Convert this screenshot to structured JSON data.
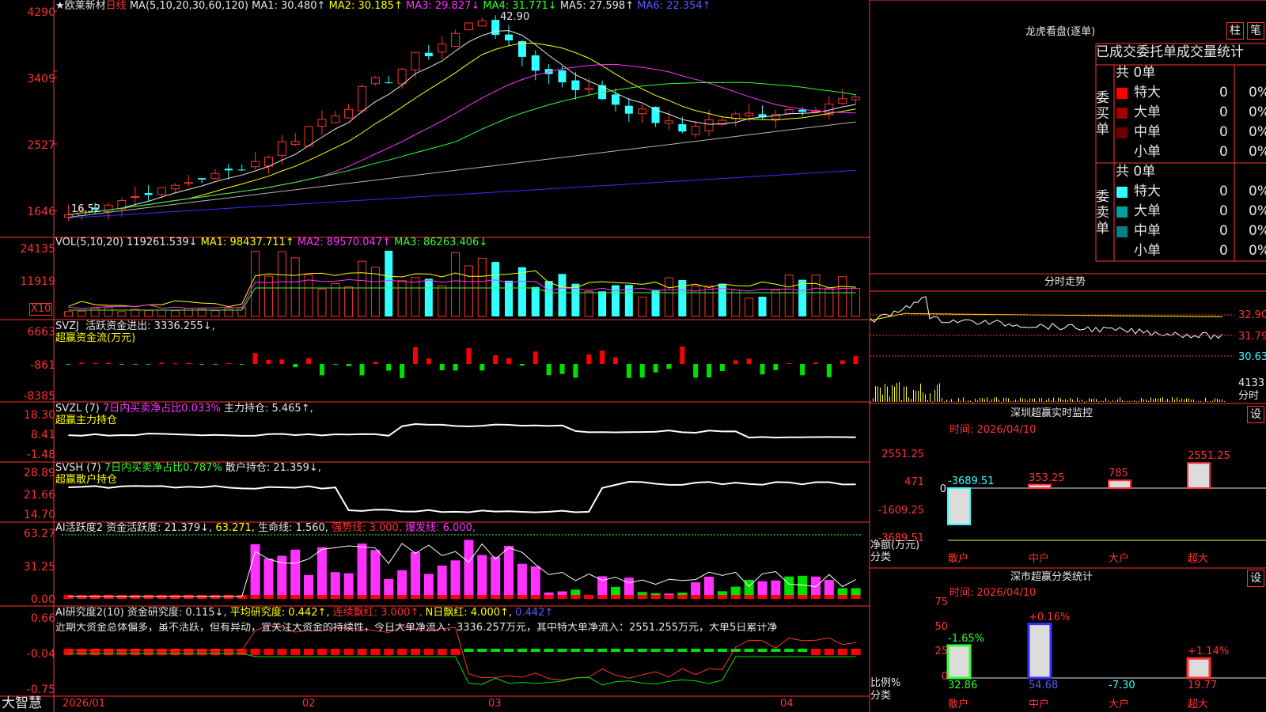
{
  "header": {
    "star": "★",
    "name": "欧莱新材",
    "period": "日线",
    "ma_params": "MA(5,10,20,30,60,120)",
    "ma1": "MA1: 30.480↑",
    "ma2": "MA2: 30.185↑",
    "ma3": "MA3: 29.827↓",
    "ma4": "MA4: 31.771↓",
    "ma5": "MA5: 27.598↑",
    "ma6": "MA6: 22.354↑",
    "high_label": "42.90",
    "low_label": "16.52"
  },
  "price_axis": [
    "4290",
    "3409",
    "2527",
    "1646"
  ],
  "vol": {
    "label": "VOL(5,10,20)",
    "v": "119261.539↓",
    "ma1": "MA1: 98437.711↑",
    "ma2": "MA2: 89570.047↑",
    "ma3": "MA3: 86263.406↓",
    "axis": [
      "24135",
      "11919"
    ],
    "unit": "X10"
  },
  "svzj": {
    "name": "SVZJ",
    "l1": "活跃资金进出: 3336.255↓,",
    "l2": "超赢资金流(万元)",
    "axis": [
      "6663",
      "-861",
      "-8385"
    ]
  },
  "svzl": {
    "name": "SVZL (7)",
    "l1": "7日内买卖净占比0.033%",
    "l2": "主力持仓: 5.465↑,",
    "l3": "超赢主力持仓",
    "axis": [
      "18.30",
      "8.41",
      "-1.48"
    ]
  },
  "svsh": {
    "name": "SVSH (7)",
    "l1": "7日内买卖净占比0.787%",
    "l2": "散户持仓: 21.359↓,",
    "l3": "超赢散户持仓",
    "axis": [
      "28.89",
      "21.66",
      "14.70"
    ]
  },
  "ai": {
    "name": "AI活跃度2",
    "l1": "资金活跃度: 21.379↓,",
    "l2": "63.271,",
    "l3": "生命线: 1.560,",
    "l4": "强势线: 3.000,",
    "l5": "爆发线: 6.000,",
    "axis": [
      "63.27",
      "31.25",
      "0.00"
    ]
  },
  "airs": {
    "name": "AI研究度2(10)",
    "l1": "资金研究度: 0.115↓,",
    "l2": "平均研究度: 0.442↑,",
    "l3": "连续飘红: 3.000↑,",
    "l4": "N日飘红: 4.000↑,",
    "l5": "0.442↑",
    "comment": "近期大资金总体偏多，虽不活跃，但有异动，宜关注大资金的持续性，今日大单净流入：3336.257万元，其中特大单净流入：2551.255万元，大单5日累计净",
    "axis": [
      "0.66",
      "-0.04",
      "-0.75"
    ]
  },
  "xaxis": [
    "2026/01",
    "02",
    "03",
    "04"
  ],
  "footer": "大智慧",
  "right": {
    "lhk_title": "龙虎看盘(逐单)",
    "btn1": "柱",
    "btn2": "笔",
    "tabs": "已成交委托单成交量统计",
    "buy_label": "委买单",
    "sell_label": "委卖单",
    "buy_total": "共 0单",
    "sell_total": "共 0单",
    "buy_rows": [
      {
        "n": "特大",
        "v": "0",
        "p": "0%",
        "c": "#ff0000"
      },
      {
        "n": "大单",
        "v": "0",
        "p": "0%",
        "c": "#a00000"
      },
      {
        "n": "中单",
        "v": "0",
        "p": "0%",
        "c": "#6e0000"
      },
      {
        "n": "小单",
        "v": "0",
        "p": "0%",
        "c": ""
      }
    ],
    "sell_rows": [
      {
        "n": "特大",
        "v": "0",
        "p": "0%",
        "c": "#32ffff"
      },
      {
        "n": "大单",
        "v": "0",
        "p": "0%",
        "c": "#00a0a0"
      },
      {
        "n": "中单",
        "v": "0",
        "p": "0%",
        "c": "#008080"
      },
      {
        "n": "小单",
        "v": "0",
        "p": "0%",
        "c": ""
      }
    ],
    "fs_title": "分时走势",
    "fs_axis": [
      "32.90",
      "31.79",
      "30.63"
    ],
    "fs_vol": "4133",
    "fs_vol_unit": "分时",
    "mon_title": "深圳超赢实时监控",
    "mon_btn": "设",
    "mon_time": "时间: 2026/04/10",
    "mon_axis": [
      "2551.25",
      "471",
      "0",
      "-1609.25",
      "-3689.51"
    ],
    "mon_unit": "净额(万元)",
    "mon_cat_lbl": "分类",
    "mon_vals": [
      "-3689.51",
      "353.25",
      "785",
      "2551.25"
    ],
    "mon_cats": [
      "散户",
      "中户",
      "大户",
      "超大"
    ],
    "cls_title": "深市超赢分类统计",
    "cls_btn": "设",
    "cls_time": "时间: 2026/04/10",
    "cls_axis": [
      "75",
      "50",
      "25",
      "0"
    ],
    "cls_unit": "比例%",
    "cls_cat_lbl": "分类",
    "cls_pct": [
      "-1.65%",
      "+0.16%",
      "",
      "+1.14%"
    ],
    "cls_vals": [
      "32.86",
      "54.68",
      "-7.30",
      "19.77"
    ],
    "cls_cats": [
      "散户",
      "中户",
      "大户",
      "超大"
    ]
  },
  "chart_data": {
    "type": "candlestick",
    "title": "欧莱新材 日线",
    "xlabel": "",
    "ylabel": "",
    "ylim": [
      16.46,
      42.9
    ],
    "x": [
      "2026/01",
      "02",
      "03",
      "04"
    ],
    "dates_note": "",
    "series": [
      {
        "name": "MA1",
        "values": [
          30.48
        ]
      },
      {
        "name": "MA2",
        "values": [
          30.185
        ]
      },
      {
        "name": "MA3",
        "values": [
          29.827
        ]
      },
      {
        "name": "MA4",
        "values": [
          31.771
        ]
      },
      {
        "name": "MA5",
        "values": [
          27.598
        ]
      },
      {
        "name": "MA6",
        "values": [
          22.354
        ]
      }
    ]
  }
}
